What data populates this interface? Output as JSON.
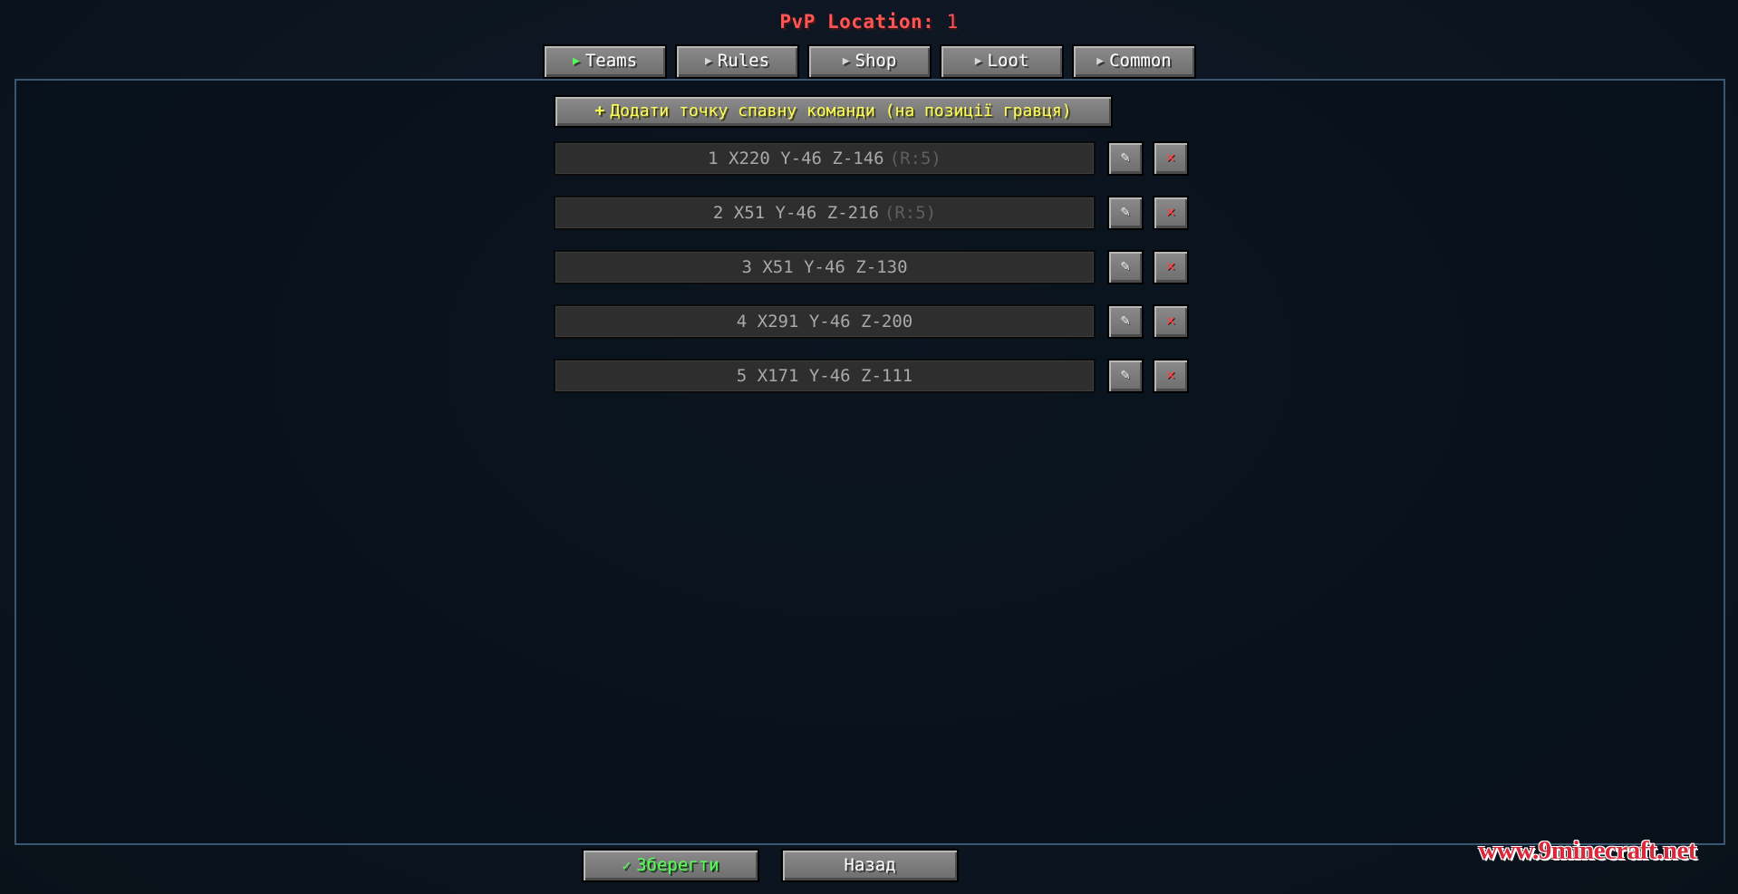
{
  "header": {
    "title": "PvP Location:",
    "location_number": "1"
  },
  "tabs": [
    {
      "label": "Teams",
      "active": true
    },
    {
      "label": "Rules",
      "active": false
    },
    {
      "label": "Shop",
      "active": false
    },
    {
      "label": "Loot",
      "active": false
    },
    {
      "label": "Common",
      "active": false
    }
  ],
  "colors": {
    "title": "#ff5555",
    "active_tab_arrow": "#55ff55",
    "add_button_text": "#ffff55",
    "save_text": "#55ff55",
    "delete_icon": "#ff4848",
    "panel_border": "#3a5670"
  },
  "icons": {
    "tab_arrow": "play-arrow-icon",
    "add": "plus-icon",
    "edit": "pencil-icon",
    "delete": "close-icon",
    "save": "checkmark-icon"
  },
  "add_button": {
    "plus": "+",
    "label": "Додати точку спавну команди (на позиції гравця)"
  },
  "spawn_points": [
    {
      "text": "1 X220 Y-46 Z-146",
      "radius": "(R:5)",
      "edit": "✎",
      "delete": "✕"
    },
    {
      "text": "2 X51 Y-46 Z-216",
      "radius": "(R:5)",
      "edit": "✎",
      "delete": "✕"
    },
    {
      "text": "3 X51 Y-46 Z-130",
      "radius": "",
      "edit": "✎",
      "delete": "✕"
    },
    {
      "text": "4 X291 Y-46 Z-200",
      "radius": "",
      "edit": "✎",
      "delete": "✕"
    },
    {
      "text": "5 X171 Y-46 Z-111",
      "radius": "",
      "edit": "✎",
      "delete": "✕"
    }
  ],
  "footer": {
    "save_check": "✓",
    "save_label": "Зберегти",
    "back_label": "Назад"
  },
  "watermark": "www.9minecraft.net"
}
